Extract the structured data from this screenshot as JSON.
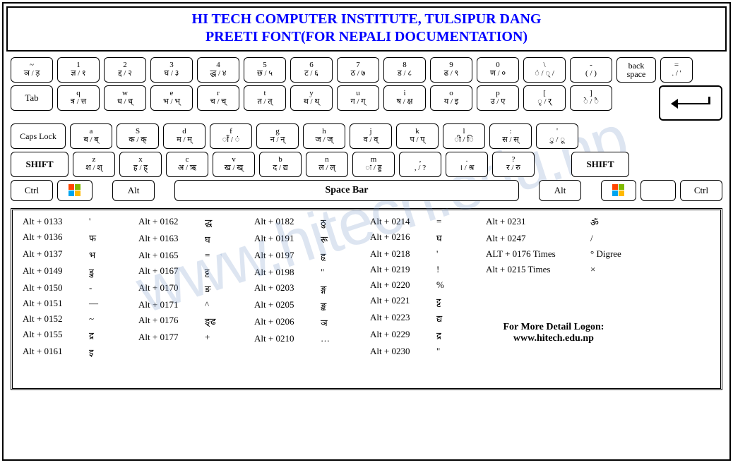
{
  "header": {
    "line1": "HI TECH COMPUTER INSTITUTE, TULSIPUR DANG",
    "line2": "PREETI FONT(FOR NEPALI DOCUMENTATION)"
  },
  "watermark": "www.hitech.edu.np",
  "row1": [
    {
      "top": "~",
      "bot": "ञ / ड़"
    },
    {
      "top": "1",
      "bot": "ज्ञ / १"
    },
    {
      "top": "2",
      "bot": "द्द / २"
    },
    {
      "top": "3",
      "bot": "घ / ३"
    },
    {
      "top": "4",
      "bot": "द्ध / ४"
    },
    {
      "top": "5",
      "bot": "छ / ५"
    },
    {
      "top": "6",
      "bot": "ट / ६"
    },
    {
      "top": "7",
      "bot": "ठ / ७"
    },
    {
      "top": "8",
      "bot": "ड / ८"
    },
    {
      "top": "9",
      "bot": "ढ / ९"
    },
    {
      "top": "0",
      "bot": "ण / ०"
    },
    {
      "top": "\\",
      "bot": "ं / ् /"
    },
    {
      "top": "-",
      "bot": "( / )"
    }
  ],
  "row1_back": "back space",
  "row1_eq": {
    "top": "=",
    "bot": ". / '"
  },
  "row2_tab": "Tab",
  "row2": [
    {
      "top": "q",
      "bot": "त्र / त्त"
    },
    {
      "top": "w",
      "bot": "ध / ध्"
    },
    {
      "top": "e",
      "bot": "भ / भ्"
    },
    {
      "top": "r",
      "bot": "च / च्"
    },
    {
      "top": "t",
      "bot": "त / त्"
    },
    {
      "top": "y",
      "bot": "थ / थ्"
    },
    {
      "top": "u",
      "bot": "ग / ग्"
    },
    {
      "top": "i",
      "bot": "ष / क्ष"
    },
    {
      "top": "o",
      "bot": "य / इ"
    },
    {
      "top": "p",
      "bot": "उ / ए"
    },
    {
      "top": "[",
      "bot": "ृ / र्"
    },
    {
      "top": "]",
      "bot": "े / ै"
    }
  ],
  "row3_caps": "Caps Lock",
  "row3": [
    {
      "top": "a",
      "bot": "ब / ब्"
    },
    {
      "top": "S",
      "bot": "क / क्"
    },
    {
      "top": "d",
      "bot": "म / म्"
    },
    {
      "top": "f",
      "bot": "ाँ / ं"
    },
    {
      "top": "g",
      "bot": "न / न्"
    },
    {
      "top": "h",
      "bot": "ज / ज्"
    },
    {
      "top": "j",
      "bot": "व / व्"
    },
    {
      "top": "k",
      "bot": "प / प्"
    },
    {
      "top": "l",
      "bot": "ी / ि"
    },
    {
      "top": ":",
      "bot": "स / स्"
    },
    {
      "top": "'",
      "bot": "ु / ू"
    }
  ],
  "row4_shift": "SHIFT",
  "row4": [
    {
      "top": "z",
      "bot": "श / श्"
    },
    {
      "top": "x",
      "bot": "ह / ह्"
    },
    {
      "top": "c",
      "bot": "अ / ऋ"
    },
    {
      "top": "v",
      "bot": "ख / ख्"
    },
    {
      "top": "b",
      "bot": "द / द्य"
    },
    {
      "top": "n",
      "bot": "ल / ल्"
    },
    {
      "top": "m",
      "bot": "ः / ड्ड"
    },
    {
      "top": ",",
      "bot": ", / ?"
    },
    {
      "top": ".",
      "bot": "। / श्र"
    },
    {
      "top": "?",
      "bot": "र / रु"
    }
  ],
  "row5": {
    "ctrl": "Ctrl",
    "alt": "Alt",
    "space": "Space Bar"
  },
  "alt_col1": [
    {
      "c": "Alt + 0133",
      "s": "'"
    },
    {
      "c": "Alt + 0136",
      "s": "फ"
    },
    {
      "c": "Alt + 0137",
      "s": "भ"
    },
    {
      "c": "Alt + 0149",
      "s": "डु"
    },
    {
      "c": "Alt + 0150",
      "s": "-"
    },
    {
      "c": "Alt + 0151",
      "s": "—"
    },
    {
      "c": "Alt + 0152",
      "s": "~"
    },
    {
      "c": "Alt + 0155",
      "s": "द्र"
    },
    {
      "c": "Alt + 0161",
      "s": "इ"
    }
  ],
  "alt_col2": [
    {
      "c": "Alt + 0162",
      "s": "द्ध"
    },
    {
      "c": "Alt + 0163",
      "s": "घ"
    },
    {
      "c": "Alt + 0165",
      "s": "="
    },
    {
      "c": "Alt + 0167",
      "s": "ट्ट"
    },
    {
      "c": "Alt + 0170",
      "s": "ङ"
    },
    {
      "c": "Alt + 0171",
      "s": "^"
    },
    {
      "c": "Alt + 0176",
      "s": "ङ्ढ"
    },
    {
      "c": "Alt + 0177",
      "s": "+"
    }
  ],
  "alt_col3": [
    {
      "c": "Alt + 0182",
      "s": "ठु"
    },
    {
      "c": "Alt + 0191",
      "s": "रू"
    },
    {
      "c": "Alt + 0197",
      "s": "हृ"
    },
    {
      "c": "Alt + 0198",
      "s": "\""
    },
    {
      "c": "Alt + 0203",
      "s": "ङ्ग"
    },
    {
      "c": "Alt + 0205",
      "s": "ङ्क"
    },
    {
      "c": "Alt + 0206",
      "s": "ञ"
    },
    {
      "c": "Alt + 0210",
      "s": "…"
    }
  ],
  "alt_col4": [
    {
      "c": "Alt + 0214",
      "s": "="
    },
    {
      "c": "Alt + 0216",
      "s": "घ"
    },
    {
      "c": "Alt + 0218",
      "s": "'"
    },
    {
      "c": "Alt + 0219",
      "s": "!"
    },
    {
      "c": "Alt + 0220",
      "s": "%"
    },
    {
      "c": "Alt + 0221",
      "s": "ट्ट"
    },
    {
      "c": "Alt + 0223",
      "s": "द्य"
    },
    {
      "c": "Alt + 0229",
      "s": "द्र"
    },
    {
      "c": "Alt + 0230",
      "s": "\""
    }
  ],
  "alt_col5": [
    {
      "c": "Alt + 0231",
      "s": "ॐ"
    },
    {
      "c": "Alt + 0247",
      "s": "/"
    },
    {
      "c": "ALT + 0176 Times",
      "s": "° Digree"
    },
    {
      "c": "Alt + 0215  Times",
      "s": "×"
    }
  ],
  "footer": {
    "l1": "For More Detail Logon:",
    "l2": "www.hitech.edu.np"
  }
}
